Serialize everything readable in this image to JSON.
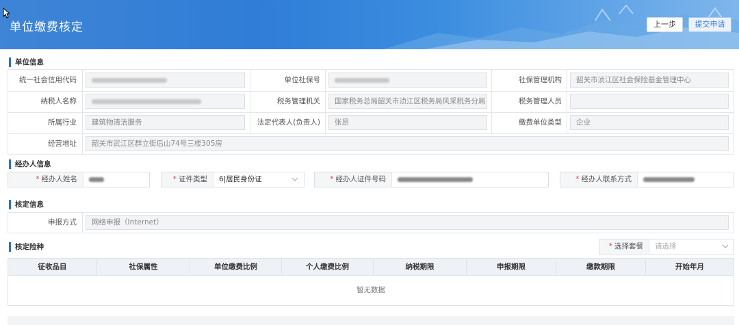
{
  "header": {
    "title": "单位缴费核定",
    "prev_label": "上一步",
    "submit_label": "提交申请"
  },
  "sections": {
    "unit": "单位信息",
    "agent": "经办人信息",
    "verify": "核定信息",
    "insurance": "核定险种"
  },
  "unit": {
    "credit_code_label": "统一社会信用代码",
    "social_no_label": "单位社保号",
    "si_agency_label": "社保管理机构",
    "si_agency_value": "韶关市浈江区社会保险基金管理中心",
    "taxpayer_label": "纳税人名称",
    "tax_org_label": "税务管理机关",
    "tax_org_value": "国家税务总局韶关市浈江区税务局风采税务分局",
    "tax_officer_label": "税务管理人员",
    "industry_label": "所属行业",
    "industry_value": "建筑物清洁服务",
    "legal_rep_label": "法定代表人(负责人)",
    "legal_rep_value": "张昂",
    "unit_type_label": "缴费单位类型",
    "unit_type_value": "企业",
    "address_label": "经营地址",
    "address_value": "韶关市武江区群立街后山74号三楼305房"
  },
  "agent": {
    "name_label": "经办人姓名",
    "id_type_label": "证件类型",
    "id_type_value": "6|居民身份证",
    "id_no_label": "经办人证件号码",
    "phone_label": "经办人联系方式"
  },
  "verify": {
    "method_label": "申报方式",
    "method_value": "网络申报（Internet）"
  },
  "insurance": {
    "package_label": "选择套餐",
    "package_placeholder": "请选择",
    "columns": [
      "征收品目",
      "社保属性",
      "单位缴费比例",
      "个人缴费比例",
      "纳税期限",
      "申报期限",
      "缴款期限",
      "开始年月"
    ],
    "empty_text": "暂无数据"
  },
  "icons": {
    "cursor": "cursor-arrow-icon",
    "chevron": "chevron-down-icon"
  },
  "colors": {
    "accent": "#2a73c9",
    "required": "#e23b3b"
  }
}
